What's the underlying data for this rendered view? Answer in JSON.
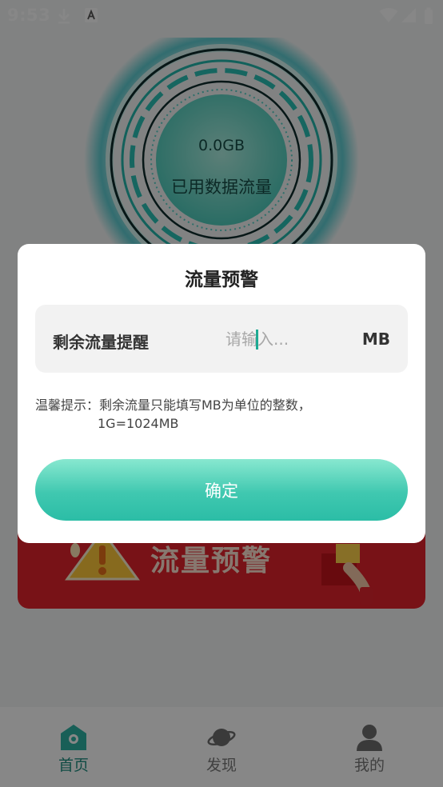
{
  "status_bar": {
    "time": "9:53"
  },
  "gauge": {
    "value": "0.0GB",
    "label": "已用数据流量"
  },
  "banner": {
    "text": "流量预警"
  },
  "bottom_nav": {
    "items": [
      {
        "label": "首页",
        "active": true
      },
      {
        "label": "发现",
        "active": false
      },
      {
        "label": "我的",
        "active": false
      }
    ]
  },
  "dialog": {
    "title": "流量预警",
    "field_label": "剩余流量提醒",
    "input_placeholder": "请输入...",
    "input_value": "",
    "unit": "MB",
    "tip_line1": "温馨提示：剩余流量只能填写MB为单位的整数，",
    "tip_line2": "1G=1024MB",
    "confirm_label": "确定"
  },
  "colors": {
    "accent": "#2bbda6",
    "banner": "#e2222c",
    "active_nav": "#1f8f80"
  }
}
